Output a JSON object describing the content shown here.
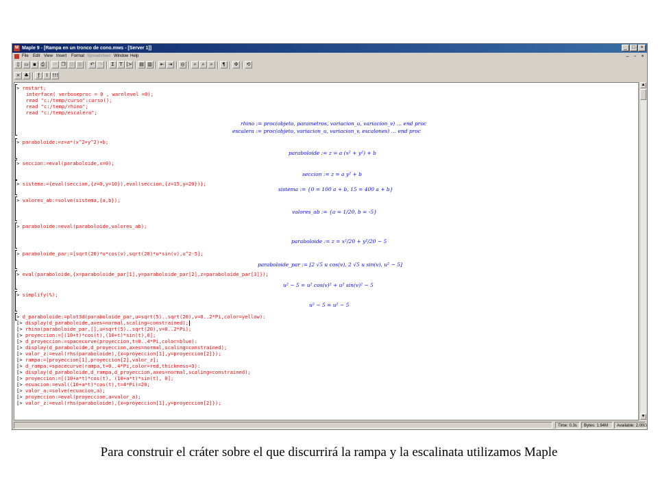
{
  "window": {
    "title": "Maple 9 - [Rampa en un tronco de cono.mws - [Server 1]]",
    "app_icon": "maple-leaf-icon",
    "accent": "#0a246a"
  },
  "menu": [
    "File",
    "Edit",
    "View",
    "Insert",
    "Format",
    "Spreadsheet",
    "Window",
    "Help"
  ],
  "toolbar1": [
    "new-file-icon",
    "open-icon",
    "save-icon",
    "print-icon",
    "cut-icon",
    "copy-icon",
    "paste-icon",
    "undo-icon",
    "redo-icon",
    "sigma-icon",
    "text-T-icon",
    "bracket-icon",
    "insert-icon",
    "indent-icon",
    "outdent-icon",
    "stop-icon",
    "zoom-100-icon",
    "zoom-200-icon",
    "zoom-400-icon",
    "pilcrow-icon",
    "expand-icon",
    "restart-icon"
  ],
  "toolbar2": [
    "close-icon",
    "leaf-icon",
    "f-x-icon",
    "italic-icon",
    "execute-icon"
  ],
  "worksheet": {
    "inputs": [
      {
        "prompt": ">",
        "lines": [
          "restart;",
          "interface( verboseproc = 0 , warnlevel =0);",
          "read \"c:/temp/curso\":curso();",
          "read \"c:/temp/rhino\";",
          "read \"c:/temp/escalera\";"
        ]
      },
      {
        "prompt": ">",
        "lines": [
          "paraboloide:=z=a*(x^2+y^2)+b;"
        ]
      },
      {
        "prompt": ">",
        "lines": [
          "seccion:=eval(paraboloide,x=0);"
        ]
      },
      {
        "prompt": ">",
        "lines": [
          "sistema:={eval(seccion,{z=0,y=10}),eval(seccion,{z=15,y=20})};"
        ]
      },
      {
        "prompt": ">",
        "lines": [
          "valores_ab:=solve(sistema,{a,b});"
        ]
      },
      {
        "prompt": ">",
        "lines": [
          "paraboloide:=eval(paraboloide,valores_ab);"
        ]
      },
      {
        "prompt": ">",
        "lines": [
          "paraboloide_par:=[sqrt(20)*u*cos(v),sqrt(20)*u*sin(v),u^2-5];"
        ]
      },
      {
        "prompt": ">",
        "lines": [
          "eval(paraboloide,{x=paraboloide_par[1],y=paraboloide_par[2],z=paraboloide_par[3]});"
        ]
      },
      {
        "prompt": ">",
        "lines": [
          "simplify(%);"
        ]
      }
    ],
    "outputs": [
      "rhino := proc(objeto, parametros, variacion_u, variacion_v)  …  end proc",
      "escalera := proc(objeto, variacion_u, variacion_v, escalones)  …  end proc",
      "paraboloide := z = a (x² + y²) + b",
      "seccion := z = a y² + b",
      "sistema := {0 = 100 a + b, 15 = 400 a + b}",
      "valores_ab := {a = 1/20, b = -5}",
      "paraboloide := z = x²/20 + y²/20 − 5",
      "paraboloide_par := [2 √5 u cos(v), 2 √5 u sin(v), u² − 5]",
      "u² − 5 = u² cos(v)² + u² sin(v)² − 5",
      "u² − 5 = u² − 5"
    ],
    "tail": [
      "d_paraboloide:=plot3d(paraboloide_par,u=sqrt(5)..sqrt(20),v=0..2*Pi,color=yellow):",
      "display(d_paraboloide,axes=normal,scaling=constrained);",
      "rhino(paraboloide_par,[],u=sqrt(5)..sqrt(20),v=0..2*Pi);",
      "proyeccion:=[(10+t)*cos(t),(10+t)*sin(t),0];",
      "d_proyeccion:=spacecurve(proyeccion,t=0..4*Pi,color=blue):",
      "display(d_paraboloide,d_proyeccion,axes=normal,scaling=constrained);",
      "valor_z:=eval(rhs(paraboloide),{x=proyeccion[1],y=proyeccion[2]});",
      "rampa:=[proyeccion[1],proyeccion[2],valor_z];",
      "d_rampa:=spacecurve(rampa,t=0..4*Pi,color=red,thickness=3):",
      "display(d_paraboloide,d_rampa,d_proyeccion,axes=normal,scaling=constrained);",
      "proyeccion:=[(10+a*t)*cos(t), (10+a*t)*sin(t), 0];",
      "ecuacion:=eval((10+a*t)*cos(t),t=4*Pi)=20;",
      "valor_a:=solve(ecuacion,a);",
      "proyeccion:=eval(proyeccion,a=valor_a);",
      "valor_z:=eval(rhs(paraboloide),{x=proyeccion[1],y=proyeccion[2]});"
    ]
  },
  "status": {
    "time": "Time: 0.3s",
    "bytes": "Bytes: 1.94M",
    "available": "Available: 2.00G"
  },
  "caption": "Para construir el cráter sobre el que discurrirá la rampa y la escalinata utilizamos Maple"
}
